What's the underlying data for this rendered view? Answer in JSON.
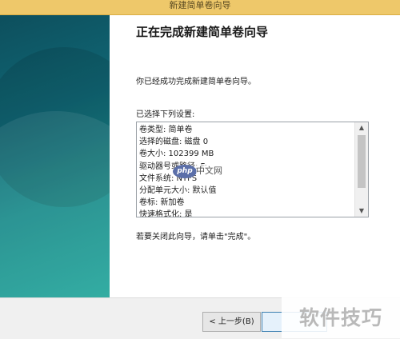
{
  "window": {
    "title": "新建简单卷向导"
  },
  "wizard": {
    "heading": "正在完成新建简单卷向导",
    "success_text": "你已经成功完成新建简单卷向导。",
    "selected_label": "已选择下列设置:",
    "settings": [
      "卷类型: 简单卷",
      "选择的磁盘: 磁盘 0",
      "卷大小: 102399 MB",
      "驱动器号或路径: F:",
      "文件系统: NTFS",
      "分配单元大小: 默认值",
      "卷标: 新加卷",
      "快速格式化: 是"
    ],
    "finish_hint": "若要关闭此向导，请单击\"完成\"。"
  },
  "buttons": {
    "back": "< 上一步(B)",
    "next": ""
  },
  "scrollbar": {
    "up_icon": "chevron-up-icon",
    "down_icon": "chevron-down-icon",
    "up_glyph": "▲",
    "down_glyph": "▼"
  },
  "watermarks": {
    "php_logo": "php",
    "php_site": "中文网",
    "corner": "软件技巧"
  },
  "colors": {
    "sidepanel_start": "#0d4f5d",
    "sidepanel_end": "#22a69b",
    "titlebar": "#eec86a"
  }
}
